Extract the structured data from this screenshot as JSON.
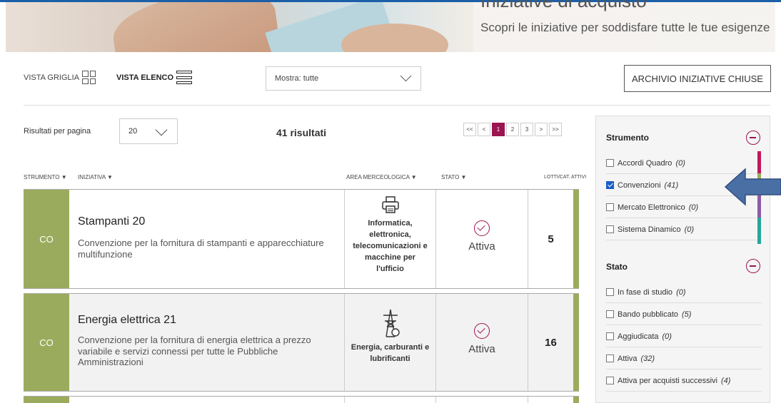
{
  "hero": {
    "title": "Iniziative di acquisto",
    "subtitle": "Scopri le iniziative per soddisfare tutte le tue esigenze"
  },
  "toolbar": {
    "grid_view_label": "VISTA GRIGLIA",
    "list_view_label": "VISTA ELENCO",
    "show_filter_value": "Mostra: tutte",
    "archive_button": "ARCHIVIO INIZIATIVE CHIUSE"
  },
  "list_controls": {
    "per_page_label": "Risultati per pagina",
    "per_page_value": "20",
    "results_count": "41 risultati",
    "pager": [
      "<<",
      "<",
      "1",
      "2",
      "3",
      ">",
      ">>"
    ],
    "current_page": "1"
  },
  "table": {
    "headers": {
      "strumento": "STRUMENTO ▼",
      "iniziativa": "INIZIATIVA ▼",
      "area": "AREA MERCEOLOGICA ▼",
      "stato": "STATO ▼",
      "lotti": "LOTTI/CAT. ATTIVI"
    },
    "rows": [
      {
        "code": "CO",
        "title": "Stampanti 20",
        "description": "Convenzione per la fornitura di stampanti e apparecchiature multifunzione",
        "area": "Informatica, elettronica, telecomunicazioni e macchine per l'ufficio",
        "area_icon": "printer-icon",
        "status": "Attiva",
        "lots": "5"
      },
      {
        "code": "CO",
        "title": "Energia elettrica 21",
        "description": "Convenzione per la fornitura di energia elettrica a prezzo variabile e servizi connessi per tutte le Pubbliche Amministrazioni",
        "area": "Energia, carburanti e lubrificanti",
        "area_icon": "power-tower-icon",
        "status": "Attiva",
        "lots": "16"
      }
    ]
  },
  "filters": {
    "strumento": {
      "title": "Strumento",
      "options": [
        {
          "label": "Accordi Quadro",
          "count": "(0)",
          "checked": false,
          "color": "#c2185b"
        },
        {
          "label": "Convenzioni",
          "count": "(41)",
          "checked": true,
          "color": "#9bab5d"
        },
        {
          "label": "Mercato Elettronico",
          "count": "(0)",
          "checked": false,
          "color": "#8e5ba8"
        },
        {
          "label": "Sistema Dinamico",
          "count": "(0)",
          "checked": false,
          "color": "#26a69a"
        }
      ]
    },
    "stato": {
      "title": "Stato",
      "options": [
        {
          "label": "In fase di studio",
          "count": "(0)",
          "checked": false
        },
        {
          "label": "Bando pubblicato",
          "count": "(5)",
          "checked": false
        },
        {
          "label": "Aggiudicata",
          "count": "(0)",
          "checked": false
        },
        {
          "label": "Attiva",
          "count": "(32)",
          "checked": false
        },
        {
          "label": "Attiva per acquisti successivi",
          "count": "(4)",
          "checked": false
        }
      ]
    }
  },
  "colors": {
    "accent": "#9b1550",
    "convenzione": "#9bab5d",
    "arrow": "#4a6fa5"
  }
}
